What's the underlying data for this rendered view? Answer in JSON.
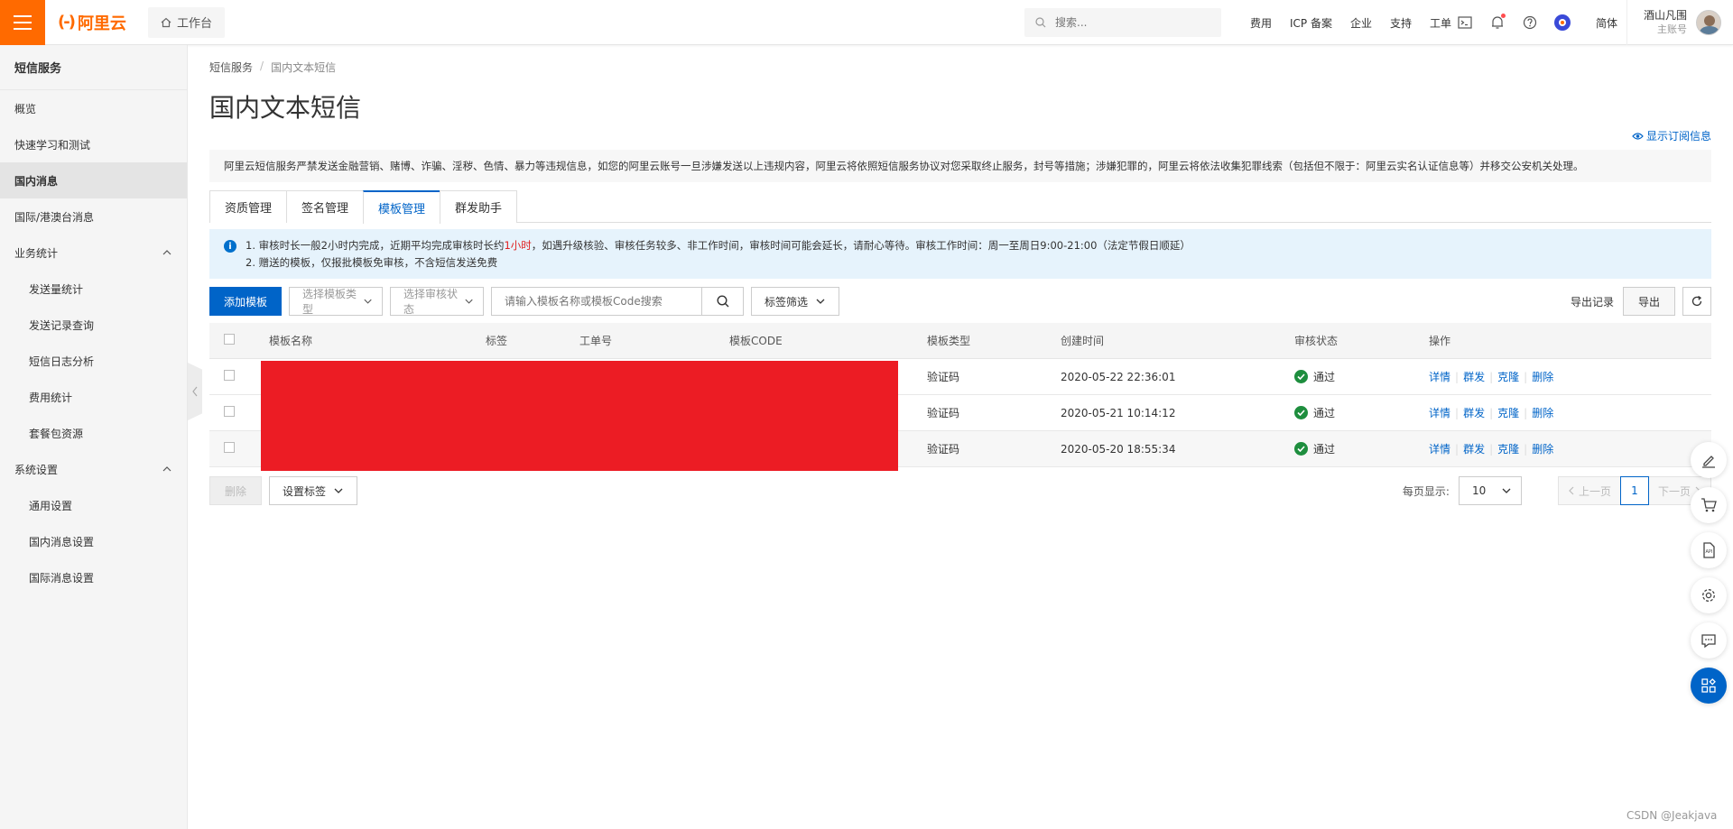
{
  "topbar": {
    "logo_text": "阿里云",
    "workbench": "工作台",
    "search_placeholder": "搜索...",
    "links": [
      "费用",
      "ICP 备案",
      "企业",
      "支持",
      "工单"
    ],
    "lang": "简体",
    "user_name": "酒山凡围",
    "user_role": "主账号"
  },
  "sidebar": {
    "title": "短信服务",
    "items": [
      {
        "label": "概览"
      },
      {
        "label": "快速学习和测试"
      },
      {
        "label": "国内消息"
      },
      {
        "label": "国际/港澳台消息"
      },
      {
        "label": "业务统计"
      },
      {
        "label": "发送量统计"
      },
      {
        "label": "发送记录查询"
      },
      {
        "label": "短信日志分析"
      },
      {
        "label": "费用统计"
      },
      {
        "label": "套餐包资源"
      },
      {
        "label": "系统设置"
      },
      {
        "label": "通用设置"
      },
      {
        "label": "国内消息设置"
      },
      {
        "label": "国际消息设置"
      }
    ]
  },
  "main": {
    "breadcrumb": [
      "短信服务",
      "/",
      "国内文本短信"
    ],
    "title": "国内文本短信",
    "show_subscription": "显示订阅信息",
    "warning": "阿里云短信服务严禁发送金融营销、赌博、诈骗、淫秽、色情、暴力等违规信息，如您的阿里云账号一旦涉嫌发送以上违规内容，阿里云将依照短信服务协议对您采取终止服务，封号等措施；涉嫌犯罪的，阿里云将依法收集犯罪线索（包括但不限于：阿里云实名认证信息等）并移交公安机关处理。",
    "tabs": [
      "资质管理",
      "签名管理",
      "模板管理",
      "群发助手"
    ],
    "info_line1_a": "1. 审核时长一般2小时内完成，近期平均完成审核时长约",
    "info_line1_hl": "1小时",
    "info_line1_b": "，如遇升级核验、审核任务较多、非工作时间，审核时间可能会延长，请耐心等待。审核工作时间：周一至周日9:00-21:00（法定节假日顺延）",
    "info_line2": "2. 赠送的模板，仅报批模板免审核，不含短信发送免费",
    "toolbar": {
      "add_button": "添加模板",
      "type_select": "选择模板类型",
      "status_select": "选择审核状态",
      "search_placeholder": "请输入模板名称或模板Code搜索",
      "tag_filter": "标签筛选",
      "export_record": "导出记录",
      "export": "导出"
    },
    "table": {
      "headers": [
        "模板名称",
        "标签",
        "工单号",
        "模板CODE",
        "模板类型",
        "创建时间",
        "审核状态",
        "操作"
      ],
      "rows": [
        {
          "type": "验证码",
          "created": "2020-05-22 22:36:01",
          "status": "通过"
        },
        {
          "type": "验证码",
          "created": "2020-05-21 10:14:12",
          "status": "通过"
        },
        {
          "type": "验证码",
          "created": "2020-05-20 18:55:34",
          "status": "通过"
        }
      ],
      "ops": [
        "详情",
        "群发",
        "克隆",
        "删除"
      ]
    },
    "footer": {
      "delete": "删除",
      "set_tag": "设置标签",
      "page_size_label": "每页显示:",
      "page_size": "10",
      "prev": "上一页",
      "page": "1",
      "next": "下一页"
    }
  },
  "watermark": "CSDN @Jeakjava",
  "colors": {
    "brand": "#ff6a00",
    "primary": "#0064c8",
    "success": "#1e8e3e",
    "redaction": "#ec1c24"
  }
}
